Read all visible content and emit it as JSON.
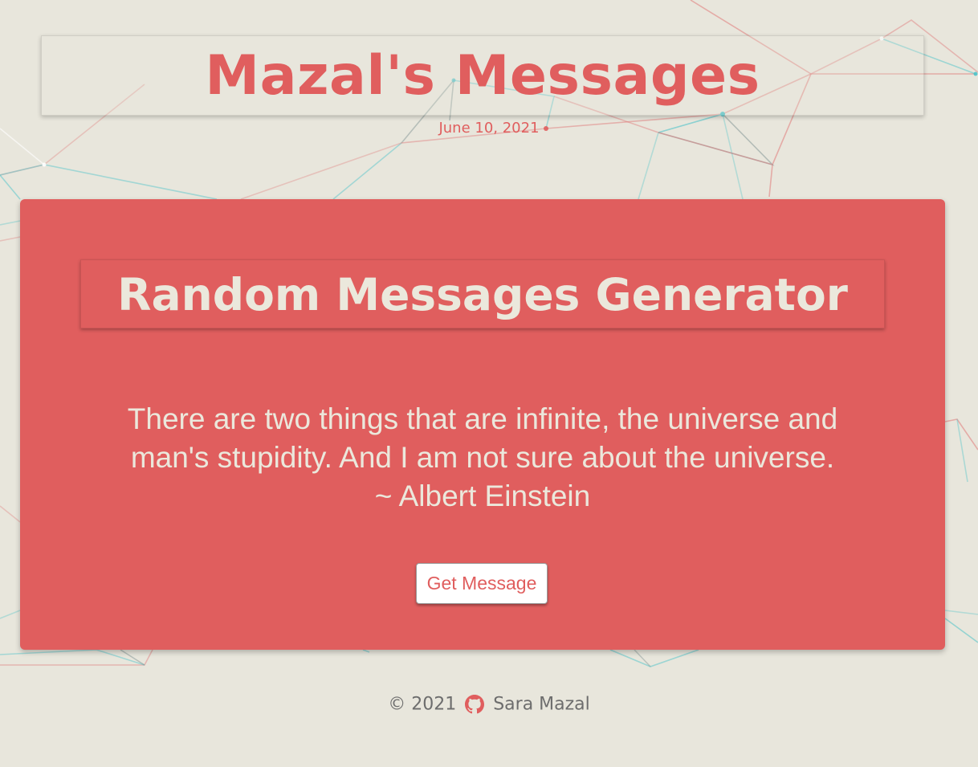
{
  "header": {
    "title": "Mazal's Messages",
    "date": "June 10, 2021"
  },
  "card": {
    "title": "Random Messages Generator",
    "quote_text": "There are two things that are infinite, the universe and man's stupidity. And I am not sure about the universe.",
    "quote_author": "~ Albert Einstein",
    "button_label": "Get Message"
  },
  "footer": {
    "copyright": "© 2021",
    "github_icon": "github-icon",
    "author": "Sara Mazal"
  },
  "colors": {
    "accent": "#e05e5e",
    "background": "#e8e6dc",
    "card_text": "#ebe8dc",
    "footer_text": "#6d6d6d",
    "line_red": "#e07a7a",
    "line_teal": "#4ec3c9"
  }
}
